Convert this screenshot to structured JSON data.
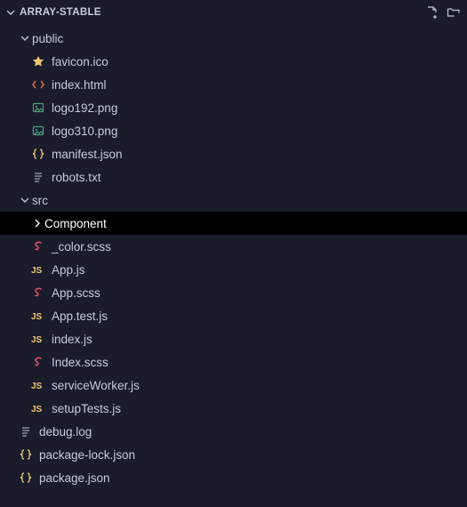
{
  "panel": {
    "title": "ARRAY-STABLE",
    "actions": {
      "newFile": "new-file",
      "newFolder": "new-folder"
    }
  },
  "colors": {
    "js": "#f0c674",
    "scss": "#e8536f",
    "html": "#d86a3f",
    "json": "#f0c674",
    "img": "#4aa07a",
    "txt": "#a0a4b8",
    "star": "#f0c674",
    "chevron": "#c0c5d8"
  },
  "tree": [
    {
      "id": "public",
      "kind": "folder",
      "depth": 0,
      "open": true,
      "icon": "chevron-down",
      "label": "public"
    },
    {
      "id": "favicon",
      "kind": "file",
      "depth": 1,
      "icon": "star",
      "label": "favicon.ico"
    },
    {
      "id": "index-html",
      "kind": "file",
      "depth": 1,
      "icon": "html",
      "label": "index.html"
    },
    {
      "id": "logo192",
      "kind": "file",
      "depth": 1,
      "icon": "image",
      "label": "logo192.png"
    },
    {
      "id": "logo310",
      "kind": "file",
      "depth": 1,
      "icon": "image",
      "label": "logo310.png"
    },
    {
      "id": "manifest",
      "kind": "file",
      "depth": 1,
      "icon": "braces",
      "label": "manifest.json"
    },
    {
      "id": "robots",
      "kind": "file",
      "depth": 1,
      "icon": "lines",
      "label": "robots.txt"
    },
    {
      "id": "src",
      "kind": "folder",
      "depth": 0,
      "open": true,
      "icon": "chevron-down",
      "label": "src"
    },
    {
      "id": "component",
      "kind": "folder",
      "depth": 1,
      "open": false,
      "icon": "chevron-right",
      "label": "Component",
      "selected": true
    },
    {
      "id": "color-scss",
      "kind": "file",
      "depth": 1,
      "icon": "sass",
      "label": "_color.scss"
    },
    {
      "id": "app-js",
      "kind": "file",
      "depth": 1,
      "icon": "js",
      "label": "App.js"
    },
    {
      "id": "app-scss",
      "kind": "file",
      "depth": 1,
      "icon": "sass",
      "label": "App.scss"
    },
    {
      "id": "app-test",
      "kind": "file",
      "depth": 1,
      "icon": "js",
      "label": "App.test.js"
    },
    {
      "id": "index-js",
      "kind": "file",
      "depth": 1,
      "icon": "js",
      "label": "index.js"
    },
    {
      "id": "index-scss",
      "kind": "file",
      "depth": 1,
      "icon": "sass",
      "label": "Index.scss"
    },
    {
      "id": "sw",
      "kind": "file",
      "depth": 1,
      "icon": "js",
      "label": "serviceWorker.js"
    },
    {
      "id": "setup",
      "kind": "file",
      "depth": 1,
      "icon": "js",
      "label": "setupTests.js"
    },
    {
      "id": "debug",
      "kind": "file",
      "depth": 0,
      "icon": "lines",
      "label": "debug.log"
    },
    {
      "id": "pkglock",
      "kind": "file",
      "depth": 0,
      "icon": "braces",
      "label": "package-lock.json"
    },
    {
      "id": "pkg",
      "kind": "file",
      "depth": 0,
      "icon": "braces",
      "label": "package.json"
    }
  ]
}
